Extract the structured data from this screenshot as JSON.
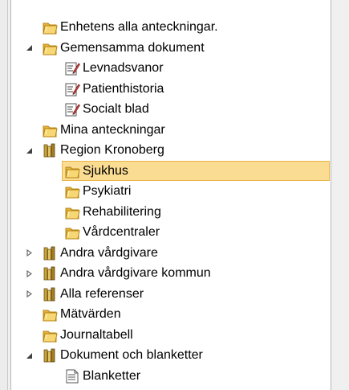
{
  "tree": [
    {
      "label": "Enhetens alla anteckningar.",
      "icon": "folder-icon",
      "level": 0,
      "expander": "none"
    },
    {
      "label": "Gemensamma dokument",
      "icon": "folder-icon",
      "level": 0,
      "expander": "expanded"
    },
    {
      "label": "Levnadsvanor",
      "icon": "form-icon",
      "level": 1,
      "expander": "none"
    },
    {
      "label": "Patienthistoria",
      "icon": "form-icon",
      "level": 1,
      "expander": "none"
    },
    {
      "label": "Socialt blad",
      "icon": "form-icon",
      "level": 1,
      "expander": "none"
    },
    {
      "label": "Mina anteckningar",
      "icon": "folder-icon",
      "level": 0,
      "expander": "none"
    },
    {
      "label": "Region Kronoberg",
      "icon": "books-icon",
      "level": 0,
      "expander": "expanded"
    },
    {
      "label": "Sjukhus",
      "icon": "folder-icon",
      "level": 1,
      "expander": "none",
      "selected": true
    },
    {
      "label": "Psykiatri",
      "icon": "folder-icon",
      "level": 1,
      "expander": "none"
    },
    {
      "label": "Rehabilitering",
      "icon": "folder-icon",
      "level": 1,
      "expander": "none"
    },
    {
      "label": "Vårdcentraler",
      "icon": "folder-icon",
      "level": 1,
      "expander": "none"
    },
    {
      "label": "Andra vårdgivare",
      "icon": "books-icon",
      "level": 0,
      "expander": "collapsed"
    },
    {
      "label": "Andra vårdgivare kommun",
      "icon": "books-icon",
      "level": 0,
      "expander": "collapsed"
    },
    {
      "label": "Alla referenser",
      "icon": "books-icon",
      "level": 0,
      "expander": "collapsed"
    },
    {
      "label": "Mätvärden",
      "icon": "folder-icon",
      "level": 0,
      "expander": "none"
    },
    {
      "label": "Journaltabell",
      "icon": "folder-icon",
      "level": 0,
      "expander": "none"
    },
    {
      "label": "Dokument och blanketter",
      "icon": "books-icon",
      "level": 0,
      "expander": "expanded"
    },
    {
      "label": "Blanketter",
      "icon": "document-icon",
      "level": 1,
      "expander": "none"
    }
  ],
  "colors": {
    "selection_fill": "#fbdc93",
    "selection_border": "#e9b64b",
    "folder": "#f2c94c"
  }
}
